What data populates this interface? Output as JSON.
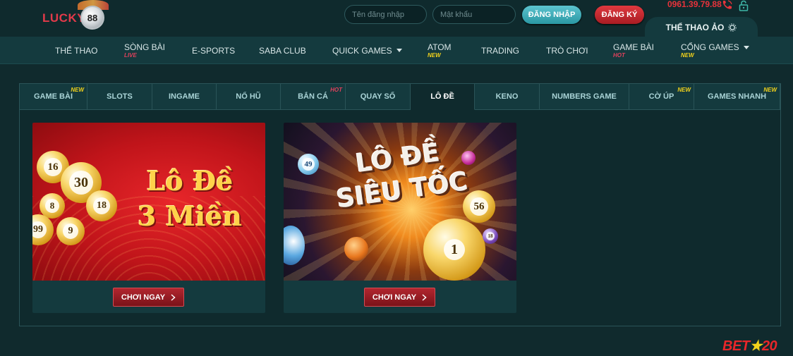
{
  "header": {
    "logo_text": "LUCKY",
    "logo_badge": "88",
    "username_placeholder": "Tên đăng nhập",
    "password_placeholder": "Mật khẩu",
    "login_label": "ĐĂNG NHẬP",
    "register_label": "ĐĂNG KÝ",
    "phone": "0961.39.79.88",
    "virtual_sports_label": "THỂ THAO ẢO"
  },
  "nav": {
    "items": [
      {
        "label": "THỂ THAO",
        "tag": ""
      },
      {
        "label": "SÒNG BÀI",
        "tag": "LIVE"
      },
      {
        "label": "E-SPORTS",
        "tag": ""
      },
      {
        "label": "SABA CLUB",
        "tag": ""
      },
      {
        "label": "QUICK GAMES",
        "tag": ""
      },
      {
        "label": "ATOM",
        "tag": "NEW"
      },
      {
        "label": "TRADING",
        "tag": ""
      },
      {
        "label": "TRÒ CHƠI",
        "tag": ""
      },
      {
        "label": "GAME BÀI",
        "tag": "HOT"
      },
      {
        "label": "CỔNG GAMES",
        "tag": "NEW"
      }
    ]
  },
  "subtabs": [
    {
      "label": "GAME BÀI",
      "badge": "NEW"
    },
    {
      "label": "SLOTS",
      "badge": ""
    },
    {
      "label": "INGAME",
      "badge": ""
    },
    {
      "label": "NỔ HŨ",
      "badge": ""
    },
    {
      "label": "BẮN CÁ",
      "badge": "HOT"
    },
    {
      "label": "QUAY SỐ",
      "badge": ""
    },
    {
      "label": "LÔ ĐỀ",
      "badge": ""
    },
    {
      "label": "KENO",
      "badge": ""
    },
    {
      "label": "NUMBERS GAME",
      "badge": ""
    },
    {
      "label": "CỜ ÚP",
      "badge": "NEW"
    },
    {
      "label": "GAMES NHANH",
      "badge": "NEW"
    }
  ],
  "active_subtab": "LÔ ĐỀ",
  "cards": [
    {
      "title_line1": "Lô Đề",
      "title_line2": "3 Miền",
      "balls": [
        "16",
        "30",
        "18",
        "9",
        "8",
        "99"
      ],
      "button_label": "CHƠI NGAY"
    },
    {
      "title_line1": "LÔ ĐỀ",
      "title_line2": "SIÊU TỐC",
      "balls": [
        "49",
        "56",
        "1",
        "18"
      ],
      "button_label": "CHƠI NGAY"
    }
  ],
  "footer": {
    "brand": "BET",
    "brand_star": "★",
    "brand_num": "20"
  },
  "colors": {
    "background": "#102a2d",
    "nav": "#143a3e",
    "brand_red": "#e8333b",
    "new_tag": "#f2d21b",
    "hot_tag": "#e0415c",
    "login_btn": "#2a97a3"
  },
  "icons": {
    "phone": "phone-icon",
    "lock": "lock-icon",
    "virtual_sports": "gear-icon",
    "play": "chevron-right-icon",
    "dropdown": "caret-down-icon"
  }
}
